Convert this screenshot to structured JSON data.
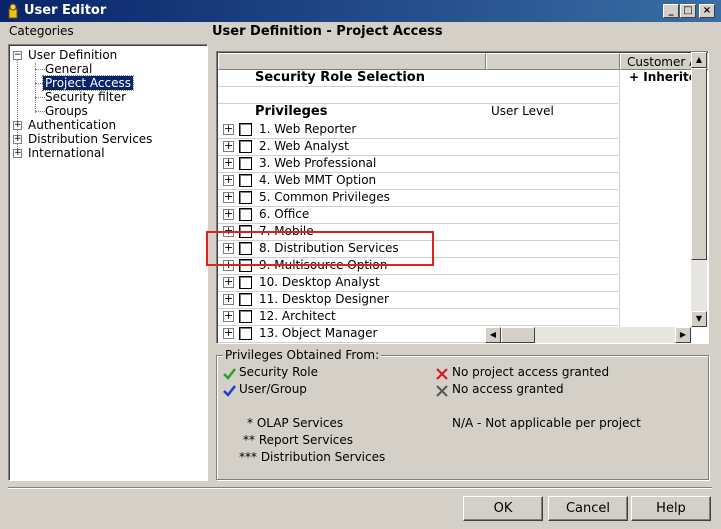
{
  "window": {
    "title": "User Editor"
  },
  "categories": {
    "heading": "Categories",
    "items": [
      {
        "label": "User Definition",
        "expander": "−"
      },
      {
        "label": "General"
      },
      {
        "label": "Project Access"
      },
      {
        "label": "Security filter"
      },
      {
        "label": "Groups"
      },
      {
        "label": "Authentication",
        "expander": "+"
      },
      {
        "label": "Distribution Services",
        "expander": "+"
      },
      {
        "label": "International",
        "expander": "+"
      }
    ]
  },
  "panel": {
    "title": "User Definition - Project Access"
  },
  "grid": {
    "column_header": "Customer A",
    "security_role_label": "Security Role Selection",
    "inherited_label": "+ Inherite",
    "privileges_label": "Privileges",
    "user_level_label": "User Level",
    "rows": [
      "1. Web Reporter",
      "2. Web Analyst",
      "3. Web Professional",
      "4. Web MMT Option",
      "5. Common Privileges",
      "6. Office",
      "7. Mobile",
      "8. Distribution Services",
      "9. Multisource Option",
      "10. Desktop Analyst",
      "11. Desktop Designer",
      "12. Architect",
      "13. Object Manager"
    ]
  },
  "legend": {
    "title": "Privileges Obtained From:",
    "security_role": "Security Role",
    "user_group": "User/Group",
    "no_project_access": "No project access granted",
    "no_access": "No access granted",
    "olap": "* OLAP Services",
    "report": "** Report Services",
    "distribution": "*** Distribution Services",
    "na": "N/A - Not applicable per project",
    "colors": {
      "green_check": "#2e9d2e",
      "blue_check": "#1f3fbf",
      "red_x": "#cc2222"
    }
  },
  "buttons": {
    "ok": "OK",
    "cancel": "Cancel",
    "help": "Help"
  },
  "titlebar_buttons": {
    "minimize": "_",
    "maximize": "□",
    "close": "×"
  }
}
